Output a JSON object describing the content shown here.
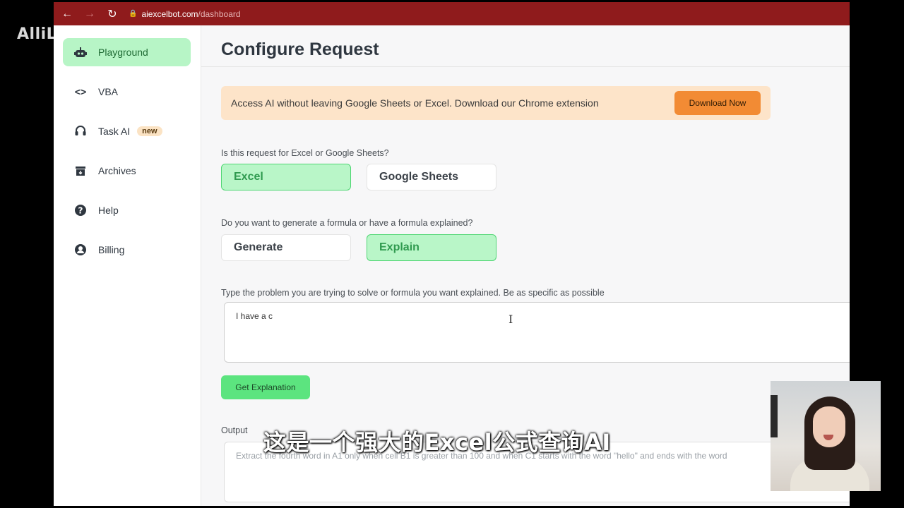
{
  "watermark": "AlliLi",
  "browser": {
    "url_host": "aiexcelbot.com",
    "url_path": "/dashboard",
    "bar_color": "#8f1b1c"
  },
  "sidebar": {
    "items": [
      {
        "label": "Playground",
        "icon": "robot-icon",
        "active": true
      },
      {
        "label": "VBA",
        "icon": "code-icon"
      },
      {
        "label": "Task AI",
        "icon": "headset-icon",
        "badge": "new"
      },
      {
        "label": "Archives",
        "icon": "archive-icon"
      },
      {
        "label": "Help",
        "icon": "help-icon"
      },
      {
        "label": "Billing",
        "icon": "account-icon"
      }
    ]
  },
  "main": {
    "title": "Configure Request",
    "banner": {
      "text": "Access AI without leaving Google Sheets or Excel. Download our Chrome extension",
      "button": "Download Now"
    },
    "q1": {
      "label": "Is this request for Excel or Google Sheets?",
      "options": [
        "Excel",
        "Google Sheets"
      ],
      "selected": "Excel"
    },
    "q2": {
      "label": "Do you want to generate a formula or have a formula explained?",
      "options": [
        "Generate",
        "Explain"
      ],
      "selected": "Explain"
    },
    "prompt": {
      "label": "Type the problem you are trying to solve or formula you want explained. Be as specific as possible",
      "value": "I have a c"
    },
    "submit_label": "Get Explanation",
    "output": {
      "label": "Output",
      "placeholder": "Extract the fourth word in A1 only when cell B1 is greater than 100 and when C1 starts with the word \"hello\" and ends with the word"
    }
  },
  "overlay": {
    "subtitle": "这是一个强大的Excel公式查询AI"
  },
  "colors": {
    "accent_green": "#5ce47f",
    "selected_green": "#b9f6c8",
    "banner_bg": "#fde4c9",
    "banner_button": "#f28b34"
  }
}
